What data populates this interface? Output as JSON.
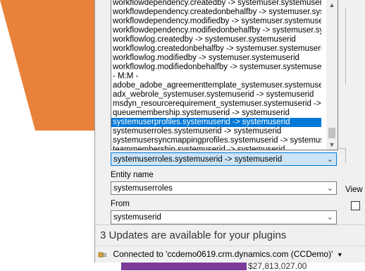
{
  "colors": {
    "accent": "#0078d7",
    "orange_bg": "#e8823a",
    "purple_bg": "#7d3c98"
  },
  "relationships_list": {
    "items": [
      "workflowdependency.createdby -> systemuser.systemuserid",
      "workflowdependency.createdonbehalfby -> systemuser.systemuserid",
      "workflowdependency.modifiedby -> systemuser.systemuserid",
      "workflowdependency.modifiedonbehalfby -> systemuser.systemuserid",
      "workflowlog.createdby -> systemuser.systemuserid",
      "workflowlog.createdonbehalfby -> systemuser.systemuserid",
      "workflowlog.modifiedby -> systemuser.systemuserid",
      "workflowlog.modifiedonbehalfby -> systemuser.systemuserid",
      "- M:M -",
      "adobe_adobe_agreementtemplate_systemuser.systemuserid -> ",
      "adx_webrole_systemuser.systemuserid -> systemuserid",
      "msdyn_resourcerequirement_systemuser.systemuserid -> syster",
      "queuemembership.systemuserid -> systemuserid",
      "systemuserprofiles.systemuserid -> systemuserid",
      "systemuserroles.systemuserid -> systemuserid",
      "systemusersyncmappingprofiles.systemuserid -> systemuserid",
      "teammembership.systemuserid -> systemuserid"
    ],
    "selected_index": 13,
    "scroll_up_icon": "chevron-up-icon",
    "scroll_down_icon": "chevron-down-icon"
  },
  "relationship_combo": {
    "value": "systemuserroles.systemuserid -> systemuserid"
  },
  "entity_name": {
    "label": "Entity name",
    "value": "systemuserroles"
  },
  "from": {
    "label": "From",
    "value": "systemuserid"
  },
  "view": {
    "label": "View"
  },
  "notification": {
    "text": "3 Updates are available for your plugins"
  },
  "status_bar": {
    "connection": "Connected to 'ccdemo0619.crm.dynamics.com (CCDemo)'",
    "dropdown_glyph": "▾"
  },
  "background": {
    "amount": "$27,813,027.00"
  }
}
